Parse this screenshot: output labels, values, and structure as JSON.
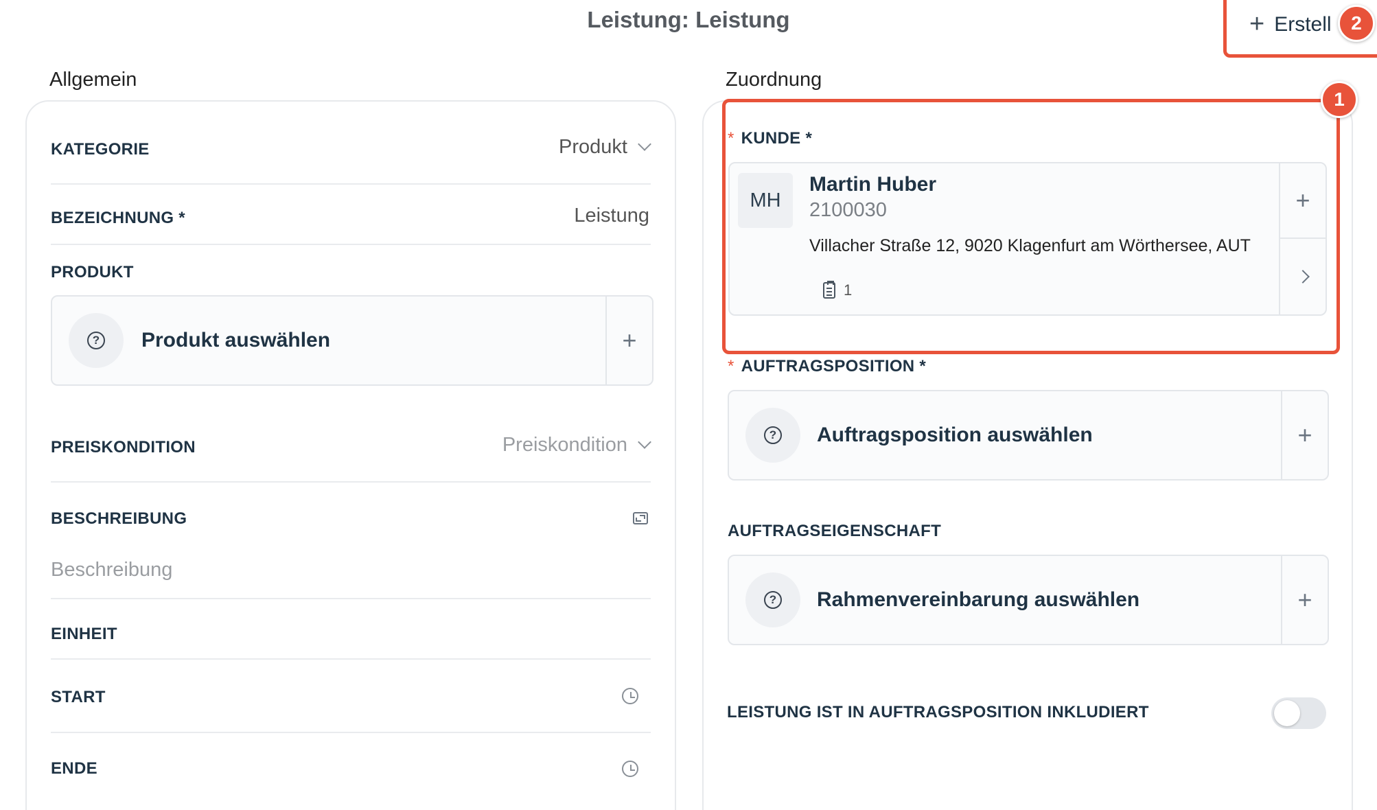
{
  "header": {
    "title": "Leistung: Leistung",
    "create_label": "Erstell",
    "create_badge": "2"
  },
  "allgemein": {
    "heading": "Allgemein",
    "kategorie": {
      "label": "KATEGORIE",
      "value": "Produkt"
    },
    "bezeichnung": {
      "label": "BEZEICHNUNG *",
      "value": "Leistung"
    },
    "produkt": {
      "label": "PRODUKT",
      "select_label": "Produkt auswählen"
    },
    "preiskondition": {
      "label": "PREISKONDITION",
      "placeholder": "Preiskondition"
    },
    "beschreibung": {
      "label": "BESCHREIBUNG",
      "placeholder": "Beschreibung"
    },
    "einheit": {
      "label": "EINHEIT"
    },
    "start": {
      "label": "START"
    },
    "ende": {
      "label": "ENDE"
    }
  },
  "zuordnung": {
    "heading": "Zuordnung",
    "kunde": {
      "label": "KUNDE *",
      "badge": "1",
      "initials": "MH",
      "name": "Martin Huber",
      "number": "2100030",
      "address": "Villacher Straße 12, 9020 Klagenfurt am Wörthersee, AUT",
      "doc_count": "1"
    },
    "auftragsposition": {
      "label": "AUFTRAGSPOSITION *",
      "select_label": "Auftragsposition auswählen"
    },
    "auftragseigenschaft": {
      "label": "AUFTRAGSEIGENSCHAFT",
      "select_label": "Rahmenvereinbarung auswählen"
    },
    "inkludiert": {
      "label": "LEISTUNG IST IN AUFTRAGSPOSITION INKLUDIERT",
      "enabled": false
    }
  },
  "colors": {
    "highlight": "#e8533a",
    "text_dark": "#1f3344",
    "border": "#e3e6ea"
  }
}
